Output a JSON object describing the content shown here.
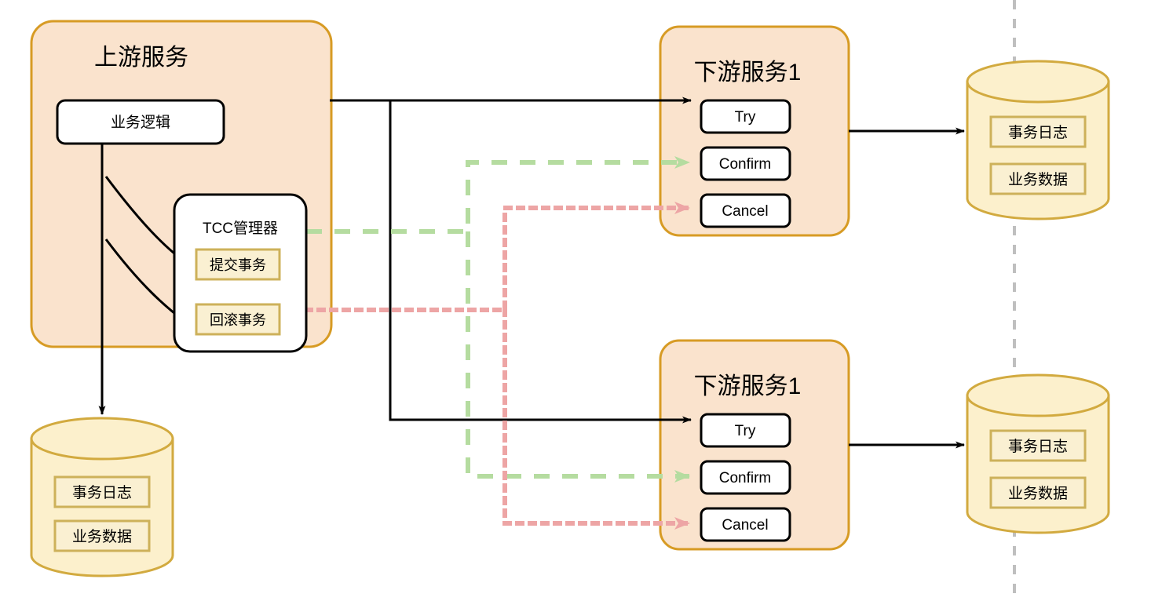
{
  "diagram": {
    "title_hidden": "",
    "colors": {
      "service_fill": "#fae3cd",
      "service_stroke": "#d79b24",
      "db_fill": "#fcf0cc",
      "db_stroke": "#d2aa3f",
      "inner_box_fill": "#faf0d2",
      "inner_box_stroke": "#cdb15a",
      "node_fill": "#ffffff",
      "node_stroke": "#000000",
      "flow_black": "#000000",
      "flow_green": "#b5dca0",
      "flow_pink": "#eda5a5",
      "guide_gray": "#bfbfbf"
    },
    "upstream": {
      "title": "上游服务",
      "business_logic": "业务逻辑",
      "tcc_manager": {
        "title": "TCC管理器",
        "items": [
          {
            "label": "提交事务"
          },
          {
            "label": "回滚事务"
          }
        ]
      }
    },
    "downstream_services": [
      {
        "title": "下游服务1",
        "actions": [
          {
            "label": "Try"
          },
          {
            "label": "Confirm"
          },
          {
            "label": "Cancel"
          }
        ]
      },
      {
        "title": "下游服务1",
        "actions": [
          {
            "label": "Try"
          },
          {
            "label": "Confirm"
          },
          {
            "label": "Cancel"
          }
        ]
      }
    ],
    "databases": [
      {
        "name": "upstream-db",
        "rows": [
          {
            "label": "事务日志"
          },
          {
            "label": "业务数据"
          }
        ]
      },
      {
        "name": "downstream-db-1",
        "rows": [
          {
            "label": "事务日志"
          },
          {
            "label": "业务数据"
          }
        ]
      },
      {
        "name": "downstream-db-2",
        "rows": [
          {
            "label": "事务日志"
          },
          {
            "label": "业务数据"
          }
        ]
      }
    ]
  }
}
